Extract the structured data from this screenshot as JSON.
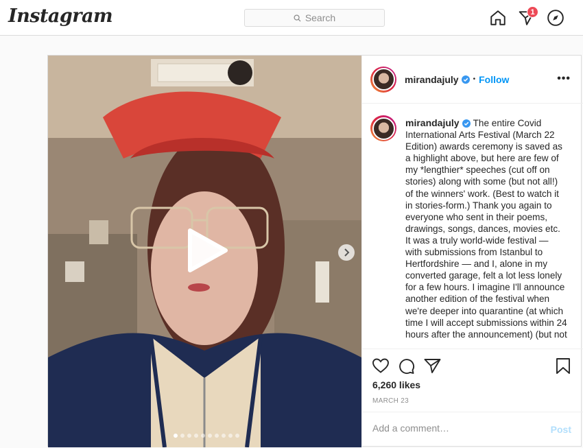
{
  "app": {
    "logo": "Instagram"
  },
  "search": {
    "placeholder": "Search"
  },
  "nav": {
    "activity_badge": "1"
  },
  "post": {
    "username": "mirandajuly",
    "follow_label": "Follow",
    "separator": "•",
    "more_label": "•••",
    "caption": "The entire Covid International Arts Festival (March 22 Edition) awards ceremony is saved as a highlight above, but here are few of my *lengthier* speeches (cut off on stories) along with some (but not all!) of the winners' work. (Best to watch it in stories-form.) Thank you again to everyone who sent in their poems, drawings, songs, dances, movies etc. It was a truly world-wide festival — with submissions from Istanbul to Hertfordshire — and I, alone in my converted garage, felt a lot less lonely for a few hours. I imagine I'll announce another edition of the festival when we're deeper into quarantine (at which time I will accept submissions within 24 hours after the announcement) (but not",
    "likes": "6,260 likes",
    "date": "MARCH 23",
    "comment_placeholder": "Add a comment…",
    "post_button": "Post",
    "carousel_count": 10,
    "carousel_active": 0
  },
  "colors": {
    "accent": "#0095f6",
    "badge": "#ed4956"
  }
}
